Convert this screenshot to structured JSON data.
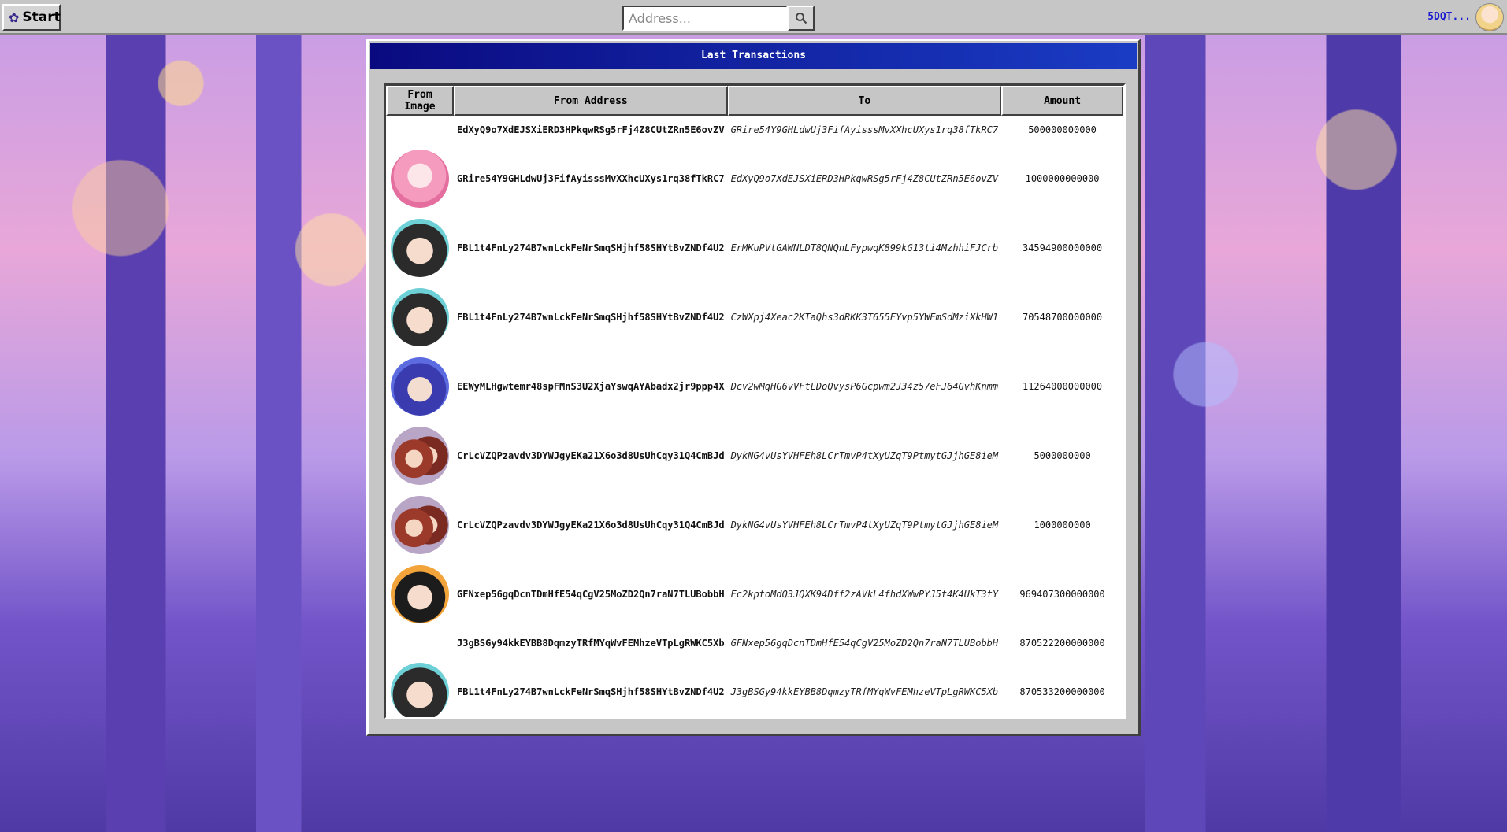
{
  "taskbar": {
    "start_label": "Start",
    "search_placeholder": "Address...",
    "user_label": "5DQT..."
  },
  "window": {
    "title": "Last Transactions"
  },
  "table": {
    "headers": [
      "From Image",
      "From Address",
      "To",
      "Amount"
    ],
    "rows": [
      {
        "avatar": "none",
        "from": "EdXyQ9o7XdEJSXiERD3HPkqwRSg5rFj4Z8CUtZRn5E6ovZV",
        "to": "GRire54Y9GHLdwUj3FifAyisssMvXXhcUXys1rq38fTkRC7",
        "amount": "500000000000"
      },
      {
        "avatar": "pink",
        "from": "GRire54Y9GHLdwUj3FifAyisssMvXXhcUXys1rq38fTkRC7",
        "to": "EdXyQ9o7XdEJSXiERD3HPkqwRSg5rFj4Z8CUtZRn5E6ovZV",
        "amount": "1000000000000"
      },
      {
        "avatar": "dark",
        "from": "FBL1t4FnLy274B7wnLckFeNrSmqSHjhf58SHYtBvZNDf4U2",
        "to": "ErMKuPVtGAWNLDT8QNQnLFypwqK899kG13ti4MzhhiFJCrb",
        "amount": "34594900000000"
      },
      {
        "avatar": "dark",
        "from": "FBL1t4FnLy274B7wnLckFeNrSmqSHjhf58SHYtBvZNDf4U2",
        "to": "CzWXpj4Xeac2KTaQhs3dRKK3T655EYvp5YWEmSdMziXkHW1",
        "amount": "70548700000000"
      },
      {
        "avatar": "blue",
        "from": "EEWyMLHgwtemr48spFMnS3U2XjaYswqAYAbadx2jr9ppp4X",
        "to": "Dcv2wMqHG6vVFtLDoQvysP6Gcpwm2J34z57eFJ64GvhKnmm",
        "amount": "11264000000000"
      },
      {
        "avatar": "brown",
        "from": "CrLcVZQPzavdv3DYWJgyEKa21X6o3d8UsUhCqy31Q4CmBJd",
        "to": "DykNG4vUsYVHFEh8LCrTmvP4tXyUZqT9PtmytGJjhGE8ieM",
        "amount": "5000000000"
      },
      {
        "avatar": "brown",
        "from": "CrLcVZQPzavdv3DYWJgyEKa21X6o3d8UsUhCqy31Q4CmBJd",
        "to": "DykNG4vUsYVHFEh8LCrTmvP4tXyUZqT9PtmytGJjhGE8ieM",
        "amount": "1000000000"
      },
      {
        "avatar": "orange",
        "from": "GFNxep56gqDcnTDmHfE54qCgV25MoZD2Qn7raN7TLUBobbH",
        "to": "Ec2kptoMdQ3JQXK94Dff2zAVkL4fhdXWwPYJ5t4K4UkT3tY",
        "amount": "969407300000000"
      },
      {
        "avatar": "none",
        "from": "J3gBSGy94kkEYBB8DqmzyTRfMYqWvFEMhzeVTpLgRWKC5Xb",
        "to": "GFNxep56gqDcnTDmHfE54qCgV25MoZD2Qn7raN7TLUBobbH",
        "amount": "870522200000000"
      },
      {
        "avatar": "dark",
        "from": "FBL1t4FnLy274B7wnLckFeNrSmqSHjhf58SHYtBvZNDf4U2",
        "to": "J3gBSGy94kkEYBB8DqmzyTRfMYqWvFEMhzeVTpLgRWKC5Xb",
        "amount": "870533200000000"
      }
    ]
  }
}
